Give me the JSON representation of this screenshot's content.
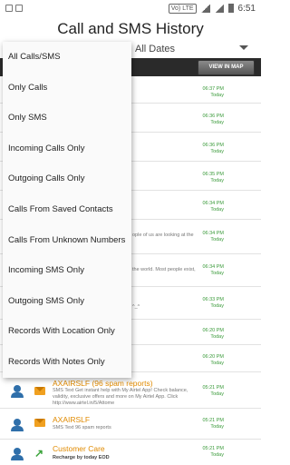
{
  "status_bar": {
    "vowifi": "Vo) LTE",
    "time": "6:51"
  },
  "header": {
    "title": "Call and SMS History"
  },
  "filter": {
    "dates_label": "All Dates"
  },
  "map_button": "VIEW IN MAP",
  "menu": {
    "items": [
      "All Calls/SMS",
      "Only Calls",
      "Only SMS",
      "Incoming Calls Only",
      "Outgoing Calls Only",
      "Calls From Saved Contacts",
      "Calls From Unknown Numbers",
      "Incoming SMS Only",
      "Outgoing SMS Only",
      "Records With Location Only",
      "Records With Notes Only"
    ]
  },
  "records_partial": [
    {
      "time": "06:37 PM",
      "day": "Today",
      "partial": ""
    },
    {
      "time": "06:36 PM",
      "day": "Today",
      "partial": ""
    },
    {
      "time": "06:36 PM",
      "day": "Today",
      "partial": ""
    },
    {
      "time": "06:35 PM",
      "day": "Today",
      "partial": ""
    },
    {
      "time": "06:34 PM",
      "day": "Today",
      "partial": ""
    },
    {
      "time": "06:34 PM",
      "day": "Today",
      "partial": "ople of us are looking at the"
    },
    {
      "time": "06:34 PM",
      "day": "Today",
      "partial": "the world. Most people exist,"
    },
    {
      "time": "06:33 PM",
      "day": "Today",
      "partial": "^_^"
    },
    {
      "time": "06:20 PM",
      "day": "Today",
      "partial": ""
    },
    {
      "time": "06:20 PM",
      "day": "Today",
      "partial": ""
    }
  ],
  "records_full": [
    {
      "name": "AXAIRSLF (96 spam reports)",
      "snippet": "SMS Text Get instant help with My Airtel App! Check balance, validity, exclusive offers and more on My Airtel App. Click http://www.airtel.in/5/Attome",
      "time": "05:21 PM",
      "day": "Today"
    },
    {
      "name": "AXAIRSLF",
      "snippet": "SMS Text 96 spam reports",
      "time": "05:21 PM",
      "day": "Today"
    },
    {
      "name": "Customer Care",
      "sub": "Recharge by today EOD",
      "time": "05:21 PM",
      "day": "Today"
    }
  ]
}
